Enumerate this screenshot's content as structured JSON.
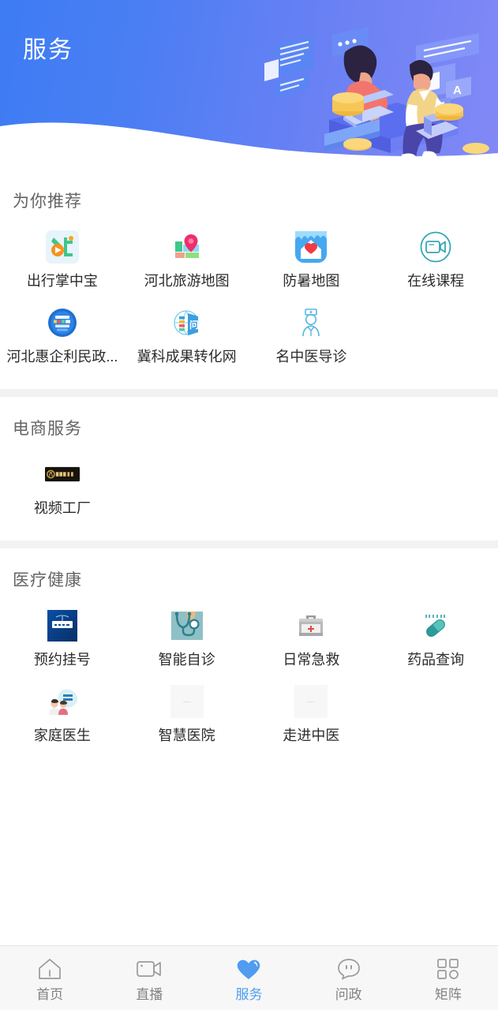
{
  "header": {
    "title": "服务",
    "gradient_from": "#3d7cf4",
    "gradient_to": "#8289f6",
    "illustration_name": "people-working-laptops-illustration"
  },
  "sections": [
    {
      "title": "为你推荐",
      "items": [
        {
          "label": "出行掌中宝",
          "icon": "travel-bus-app-icon"
        },
        {
          "label": "河北旅游地图",
          "icon": "map-pin-icon"
        },
        {
          "label": "防暑地图",
          "icon": "heatstroke-house-icon"
        },
        {
          "label": "在线课程",
          "icon": "video-course-icon"
        },
        {
          "label": "河北惠企利民政...",
          "icon": "hebei-policy-badge-icon"
        },
        {
          "label": "冀科成果转化网",
          "icon": "tech-transfer-globe-icon"
        },
        {
          "label": "名中医导诊",
          "icon": "doctor-guide-icon"
        }
      ]
    },
    {
      "title": "电商服务",
      "items": [
        {
          "label": "视频工厂",
          "icon": "video-factory-banner-icon"
        }
      ]
    },
    {
      "title": "医疗健康",
      "items": [
        {
          "label": "预约挂号",
          "icon": "appointment-registration-icon"
        },
        {
          "label": "智能自诊",
          "icon": "stethoscope-selfdiagnosis-icon"
        },
        {
          "label": "日常急救",
          "icon": "first-aid-kit-icon"
        },
        {
          "label": "药品查询",
          "icon": "medicine-capsule-icon"
        },
        {
          "label": "家庭医生",
          "icon": "family-doctor-icon"
        },
        {
          "label": "智慧医院",
          "icon": "image-placeholder-icon"
        },
        {
          "label": "走进中医",
          "icon": "image-placeholder-icon"
        }
      ]
    }
  ],
  "tabbar": {
    "active_color": "#4f9cf0",
    "inactive_color": "#828282",
    "items": [
      {
        "label": "首页",
        "icon": "home-icon",
        "active": false
      },
      {
        "label": "直播",
        "icon": "video-camera-icon",
        "active": false
      },
      {
        "label": "服务",
        "icon": "heart-icon",
        "active": true
      },
      {
        "label": "问政",
        "icon": "speech-bubble-icon",
        "active": false
      },
      {
        "label": "矩阵",
        "icon": "grid-matrix-icon",
        "active": false
      }
    ]
  }
}
